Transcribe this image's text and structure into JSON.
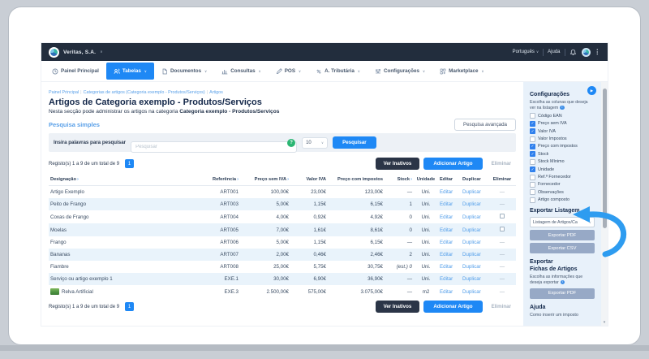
{
  "colors": {
    "accent_blue": "#1e88f5",
    "header_navy": "#222d3d",
    "dark_button": "#2b3547",
    "row_alt": "#e9f3fb",
    "sidebar_bg": "#e8f1fa",
    "export_button": "#97a9c6",
    "success_green": "#2bb673",
    "link_blue": "#4f9ce9",
    "annotation_blue": "#2e9cf0"
  },
  "icons": {
    "play": "▶",
    "chevron_down": "∨",
    "more_vertical": "⋮",
    "scroll_down": "▾",
    "sort": "›",
    "question": "?",
    "info": "i",
    "check": "✓"
  },
  "header": {
    "brand": "Veritas, S.A.",
    "language": "Português",
    "help": "Ajuda"
  },
  "nav": {
    "items": [
      {
        "slug": "painel-principal",
        "label": "Painel Principal",
        "icon": "clock",
        "active": false,
        "caret": false
      },
      {
        "slug": "tabelas",
        "label": "Tabelas",
        "icon": "users",
        "active": true,
        "caret": true
      },
      {
        "slug": "documentos",
        "label": "Documentos",
        "icon": "document",
        "active": false,
        "caret": true
      },
      {
        "slug": "consultas",
        "label": "Consultas",
        "icon": "chart",
        "active": false,
        "caret": true
      },
      {
        "slug": "pos",
        "label": "POS",
        "icon": "pos",
        "active": false,
        "caret": true
      },
      {
        "slug": "a-tributaria",
        "label": "A. Tributária",
        "icon": "tax",
        "active": false,
        "caret": true
      },
      {
        "slug": "configuracoes",
        "label": "Configurações",
        "icon": "sliders",
        "active": false,
        "caret": true
      },
      {
        "slug": "marketplace",
        "label": "Marketplace",
        "icon": "grid",
        "active": false,
        "caret": true
      }
    ]
  },
  "breadcrumb": {
    "separator": "|",
    "items": [
      "Painel Principal",
      "Categorias de artigos (Categoria exemplo - Produtos/Serviços)",
      "Artigos"
    ]
  },
  "page": {
    "title": "Artigos de Categoria exemplo - Produtos/Serviços",
    "subtitle_prefix": "Nesta secção pode administrar os artigos na categoria ",
    "subtitle_bold": "Categoria exemplo - Produtos/Serviços"
  },
  "search": {
    "section_title": "Pesquisa simples",
    "advanced_label": "Pesquisa avançada",
    "input_label": "Insira palavras para pesquisar",
    "placeholder": "Pesquisar",
    "page_size": "10",
    "button_label": "Pesquisar"
  },
  "records": {
    "summary": "Registo(s) 1 a 9 de um total de 9",
    "page": "1",
    "view_inactive": "Ver Inativos",
    "add": "Adicionar Artigo",
    "delete": "Eliminar"
  },
  "table": {
    "headers": [
      {
        "label": "Designação",
        "sort": true,
        "align": "left"
      },
      {
        "label": "Referência",
        "sort": true,
        "align": "right"
      },
      {
        "label": "Preço sem IVA",
        "sort": true,
        "align": "right"
      },
      {
        "label": "Valor IVA",
        "sort": false,
        "align": "right"
      },
      {
        "label": "Preço com impostos",
        "sort": false,
        "align": "right"
      },
      {
        "label": "Stock",
        "sort": true,
        "align": "right"
      },
      {
        "label": "Unidade",
        "sort": false,
        "align": "center"
      },
      {
        "label": "Editar",
        "sort": false,
        "align": "left"
      },
      {
        "label": "Duplicar",
        "sort": false,
        "align": "left"
      },
      {
        "label": "Eliminar",
        "sort": false,
        "align": "center"
      }
    ],
    "actions": {
      "edit": "Editar",
      "duplicate": "Duplicar"
    },
    "rows": [
      {
        "name": "Artigo Exemplo",
        "reference": "ART001",
        "price_no_vat": "100,00€",
        "vat": "23,00€",
        "price_with_tax": "123,00€",
        "stock": "—",
        "unit": "Uni.",
        "delete": "—"
      },
      {
        "name": "Peito de Frango",
        "reference": "ART003",
        "price_no_vat": "5,00€",
        "vat": "1,15€",
        "price_with_tax": "6,15€",
        "stock": "1",
        "unit": "Uni.",
        "delete": "—"
      },
      {
        "name": "Coxas de Frango",
        "reference": "ART004",
        "price_no_vat": "4,00€",
        "vat": "0,92€",
        "price_with_tax": "4,92€",
        "stock": "0",
        "unit": "Uni.",
        "delete": "checkbox"
      },
      {
        "name": "Moelas",
        "reference": "ART005",
        "price_no_vat": "7,00€",
        "vat": "1,61€",
        "price_with_tax": "8,61€",
        "stock": "0",
        "unit": "Uni.",
        "delete": "checkbox"
      },
      {
        "name": "Frango",
        "reference": "ART006",
        "price_no_vat": "5,00€",
        "vat": "1,15€",
        "price_with_tax": "6,15€",
        "stock": "—",
        "unit": "Uni.",
        "delete": "—"
      },
      {
        "name": "Bananas",
        "reference": "ART007",
        "price_no_vat": "2,00€",
        "vat": "0,46€",
        "price_with_tax": "2,46€",
        "stock": "2",
        "unit": "Uni.",
        "delete": "—"
      },
      {
        "name": "Fiambre",
        "reference": "ART008",
        "price_no_vat": "25,00€",
        "vat": "5,75€",
        "price_with_tax": "30,75€",
        "stock": "(est.) 0",
        "unit": "Uni.",
        "delete": "—"
      },
      {
        "name": "Serviço ou artigo exemplo 1",
        "reference": "EXE.1",
        "price_no_vat": "30,00€",
        "vat": "6,90€",
        "price_with_tax": "36,90€",
        "stock": "—",
        "unit": "Uni.",
        "delete": "—"
      },
      {
        "name": "Relva Artificial",
        "reference": "EXE.3",
        "price_no_vat": "2.500,00€",
        "vat": "575,00€",
        "price_with_tax": "3.075,00€",
        "stock": "—",
        "unit": "m2",
        "delete": "—",
        "thumbnail": true
      }
    ]
  },
  "sidebar": {
    "settings_title": "Configurações",
    "settings_hint": "Escolha as colunas que deseja ver na listagem",
    "columns": [
      {
        "label": "Código EAN",
        "checked": false
      },
      {
        "label": "Preço sem IVA",
        "checked": true
      },
      {
        "label": "Valor IVA",
        "checked": true
      },
      {
        "label": "Valor Impostos",
        "checked": false
      },
      {
        "label": "Preço com impostos",
        "checked": true
      },
      {
        "label": "Stock",
        "checked": true
      },
      {
        "label": "Stock Mínimo",
        "checked": false
      },
      {
        "label": "Unidade",
        "checked": true
      },
      {
        "label": "Ref.ª Fornecedor",
        "checked": false
      },
      {
        "label": "Fornecedor",
        "checked": false
      },
      {
        "label": "Observações",
        "checked": false
      },
      {
        "label": "Artigo composto",
        "checked": false
      }
    ],
    "export_list_title": "Exportar Listagem",
    "export_select_value": "Listagem de Artigos/Ca",
    "export_pdf_label": "Exportar PDF",
    "export_csv_label": "Exportar CSV",
    "export_sheets_line1": "Exportar",
    "export_sheets_line2": "Fichas de Artigos",
    "export_sheets_hint": "Escolha as informações que deseja exportar",
    "help_title": "Ajuda",
    "help_link": "Como inserir um imposto"
  }
}
